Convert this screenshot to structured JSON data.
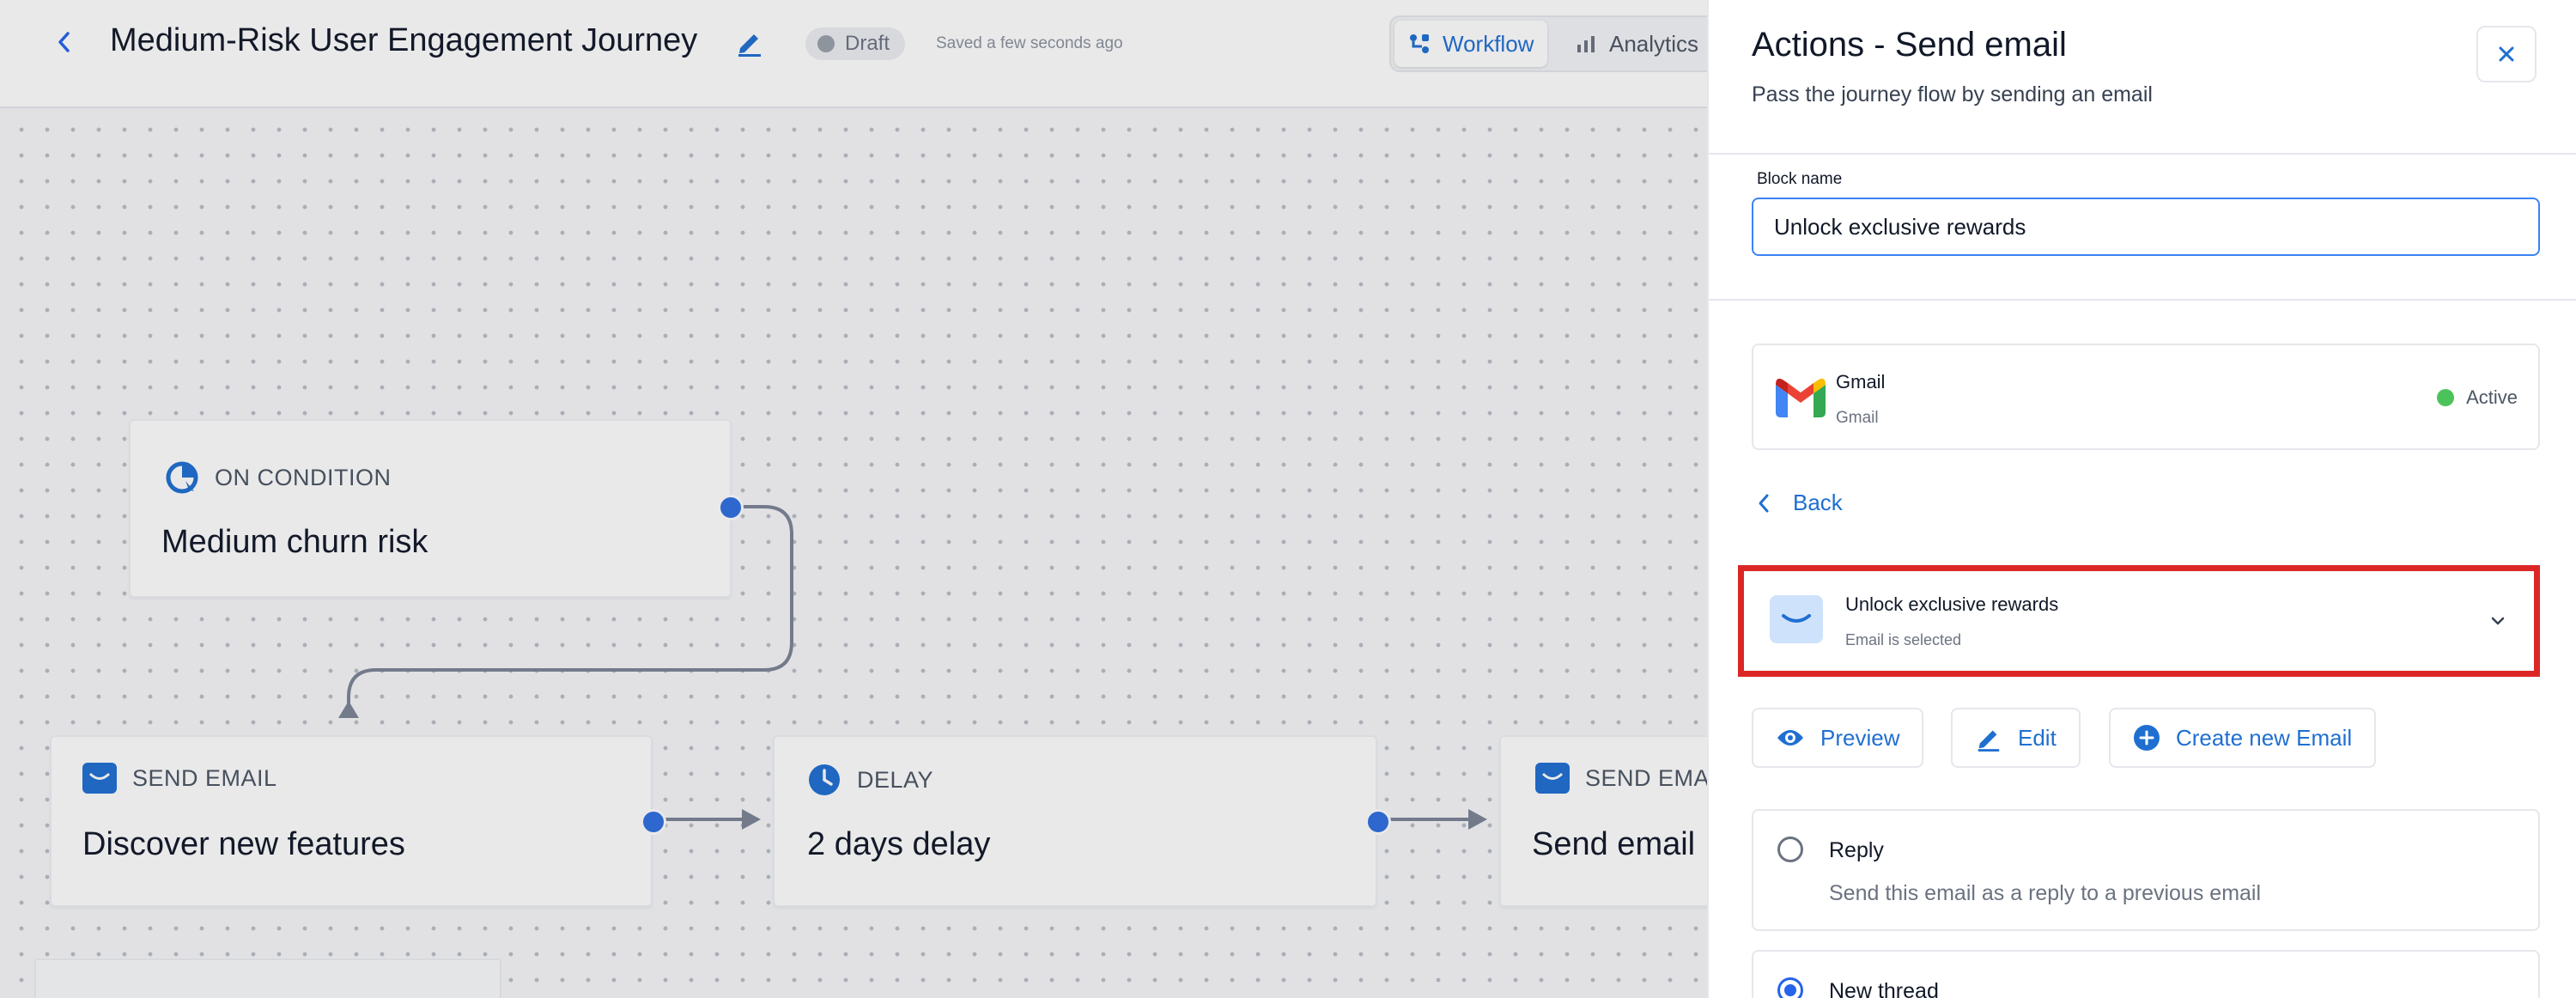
{
  "header": {
    "journey_title": "Medium-Risk User Engagement Journey",
    "status_badge": "Draft",
    "saved_text": "Saved a few seconds ago",
    "tabs": [
      {
        "label": "Workflow",
        "active": true
      },
      {
        "label": "Analytics",
        "active": false
      }
    ]
  },
  "canvas": {
    "nodes": {
      "condition": {
        "type_label": "ON CONDITION",
        "title": "Medium churn risk"
      },
      "send_email_1": {
        "type_label": "SEND EMAIL",
        "title": "Discover new features"
      },
      "delay": {
        "type_label": "DELAY",
        "title": "2 days delay"
      },
      "send_email_2": {
        "type_label": "SEND EMA",
        "title": "Send email"
      }
    }
  },
  "panel": {
    "title": "Actions - Send email",
    "subtitle": "Pass the journey flow by sending an email",
    "block_name_label": "Block name",
    "block_name_value": "Unlock exclusive rewards",
    "provider": {
      "name": "Gmail",
      "sub": "Gmail",
      "status": "Active"
    },
    "back_label": "Back",
    "selected_email": {
      "title": "Unlock exclusive rewards",
      "sub": "Email is selected"
    },
    "buttons": {
      "preview": "Preview",
      "edit": "Edit",
      "create": "Create new Email"
    },
    "reply_option": {
      "title": "Reply",
      "description": "Send this email as a reply to a previous email",
      "selected": false
    },
    "new_thread_option": {
      "title": "New thread",
      "selected": true
    }
  },
  "colors": {
    "accent": "#1f6fd1",
    "highlight_border": "#dc2626",
    "active_status": "#4cc35a"
  }
}
